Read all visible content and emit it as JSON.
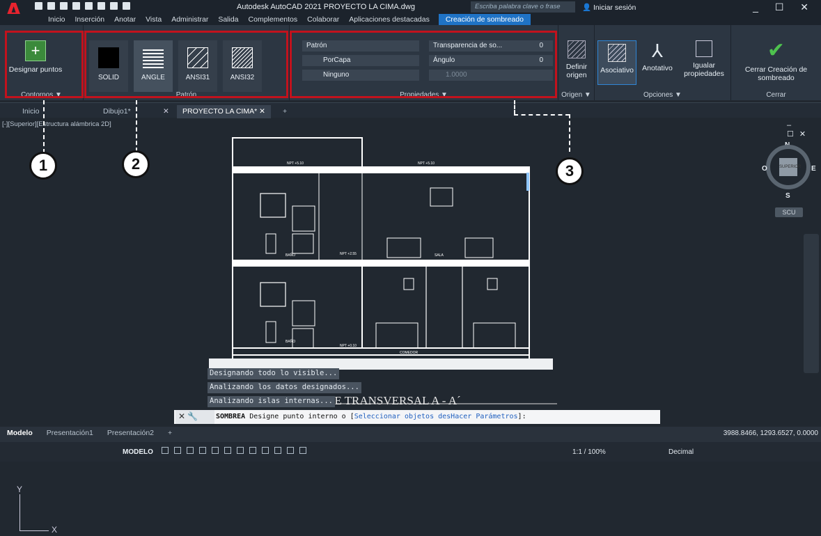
{
  "app": {
    "title": "Autodesk AutoCAD 2021   PROYECTO LA CIMA.dwg",
    "search_placeholder": "Escriba palabra clave o frase",
    "signin": "Iniciar sesión",
    "window_controls": "_ ☐ ✕"
  },
  "menu": [
    "Inicio",
    "Inserción",
    "Anotar",
    "Vista",
    "Administrar",
    "Salida",
    "Complementos",
    "Colaborar",
    "Aplicaciones destacadas"
  ],
  "menu_active": "Creación de sombreado",
  "ribbon": {
    "contornos": {
      "button": "Designar puntos",
      "label": "Contornos ▼"
    },
    "patron": {
      "label": "Patrón",
      "swatches": [
        "SOLID",
        "ANGLE",
        "ANSI31",
        "ANSI32"
      ]
    },
    "propiedades": {
      "label": "Propiedades ▼",
      "pattern": "Patrón",
      "transparency_label": "Transparencia de so...",
      "transparency_value": "0",
      "layer": "PorCapa",
      "angle_label": "Ángulo",
      "angle_value": "0",
      "background": "Ninguno",
      "scale_value": "1.0000"
    },
    "origen": {
      "button": "Definir origen",
      "label": "Origen ▼"
    },
    "opciones": {
      "asociativo": "Asociativo",
      "anotativo": "Anotativo",
      "igualar": "Igualar propiedades",
      "label": "Opciones ▼"
    },
    "cerrar": {
      "button": "Cerrar Creación de sombreado",
      "label": "Cerrar"
    }
  },
  "doc_tabs": [
    {
      "label": "Inicio"
    },
    {
      "label": "Dibujo1*"
    },
    {
      "label": "PROYECTO LA CIMA*"
    }
  ],
  "view_label": "[-][Superior][Estructura alámbrica 2D]",
  "markers": [
    "1",
    "2",
    "3"
  ],
  "viewcube": {
    "n": "N",
    "s": "S",
    "e": "E",
    "w": "O",
    "face": "SUPERIOR",
    "ucs": "SCU"
  },
  "drawing": {
    "title": "CORTE TRANSVERSAL  A - A´",
    "labels": [
      "BAÑO",
      "BAÑO",
      "SALA",
      "COMEDOR",
      "NPT +5.10",
      "NPT +5.10",
      "NPT +2.55",
      "NPT +0.10"
    ]
  },
  "command_history": [
    "Designando todo lo visible...",
    "Analizando los datos designados...",
    "Analizando islas internas..."
  ],
  "command": {
    "name": "SOMBREA",
    "prompt": "Designe punto interno o [",
    "opt1": "Seleccionar objetos",
    "opt2": "desHacer",
    "opt3": "Parámetros",
    "suffix": "]:"
  },
  "layout_tabs": [
    "Modelo",
    "Presentación1",
    "Presentación2"
  ],
  "coords": "3988.8466, 1293.6527, 0.0000",
  "status": {
    "modelo": "MODELO",
    "scale": "1:1 / 100%",
    "units": "Decimal"
  },
  "colors": {
    "accent": "#1f73c6",
    "highlight": "#c2121d",
    "close_check": "#4ec24e"
  }
}
